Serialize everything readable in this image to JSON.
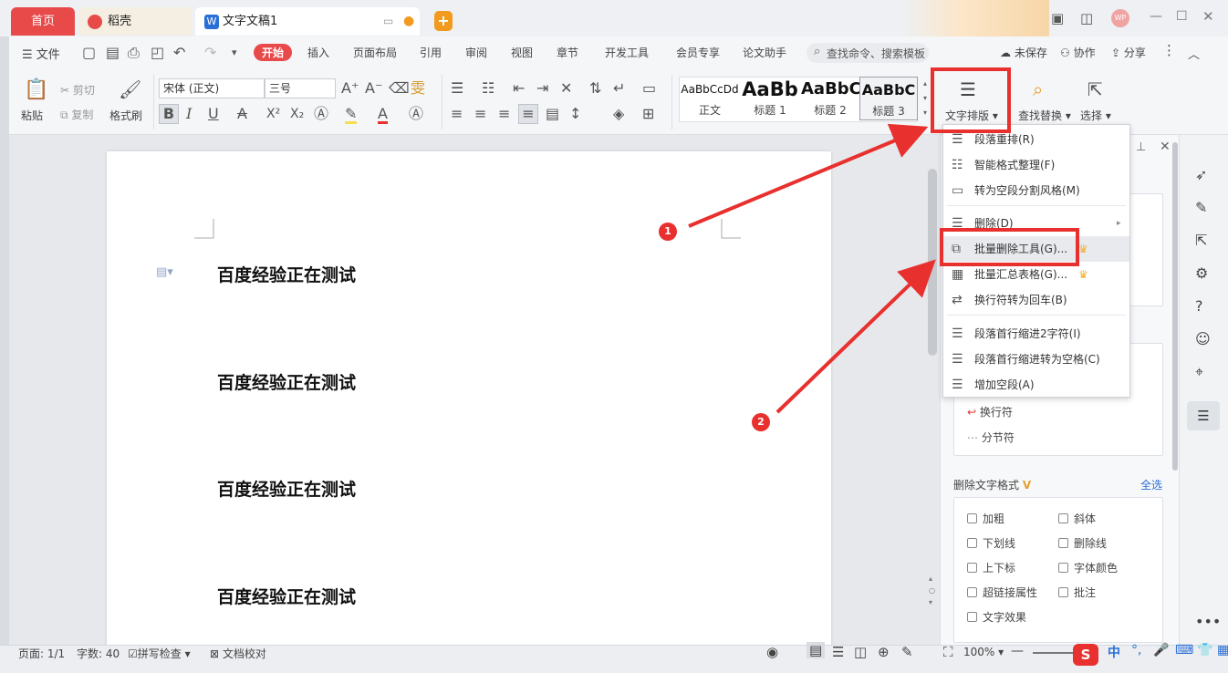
{
  "tabs": {
    "home": "首页",
    "docer": "稻壳",
    "document": "文字文稿1"
  },
  "window": {
    "avatar": "WP"
  },
  "menubar": {
    "file": "文件",
    "items": [
      "开始",
      "插入",
      "页面布局",
      "引用",
      "审阅",
      "视图",
      "章节",
      "开发工具",
      "会员专享",
      "论文助手"
    ],
    "search_placeholder": "查找命令、搜索模板",
    "unsaved": "未保存",
    "collaborate": "协作",
    "share": "分享"
  },
  "ribbon": {
    "paste": "粘贴",
    "cut": "剪切",
    "copy": "复制",
    "format_painter": "格式刷",
    "font_name": "宋体 (正文)",
    "font_size": "三号",
    "styles": [
      {
        "sample": "AaBbCcDd",
        "name": "正文"
      },
      {
        "sample": "AaBb",
        "name": "标题 1"
      },
      {
        "sample": "AaBbC",
        "name": "标题 2"
      },
      {
        "sample": "AaBbC",
        "name": "标题 3"
      }
    ],
    "text_layout": "文字排版",
    "find_replace": "查找替换",
    "select": "选择"
  },
  "document": {
    "lines": [
      "百度经验正在测试",
      "百度经验正在测试",
      "百度经验正在测试",
      "百度经验正在测试"
    ]
  },
  "dropdown": {
    "items": [
      "段落重排(R)",
      "智能格式整理(F)",
      "转为空段分割风格(M)",
      "删除(D)",
      "批量删除工具(G)...",
      "批量汇总表格(G)...",
      "换行符转为回车(B)",
      "段落首行缩进2字符(I)",
      "段落首行缩进转为空格(C)",
      "增加空段(A)"
    ]
  },
  "panel": {
    "line_break": "换行符",
    "section_break": "分节符",
    "delete_format_title": "删除文字格式",
    "select_all": "全选",
    "checkboxes": [
      "加粗",
      "斜体",
      "下划线",
      "删除线",
      "上下标",
      "字体颜色",
      "超链接属性",
      "批注",
      "文字效果"
    ]
  },
  "annotations": {
    "badge1": "1",
    "badge2": "2"
  },
  "statusbar": {
    "page": "页面: 1/1",
    "words": "字数: 40",
    "spell": "拼写检查",
    "proof": "文档校对",
    "zoom": "100%",
    "ime": "中"
  },
  "colors": {
    "accent_red": "#e8302e",
    "tab_home": "#e84a4a",
    "link_blue": "#2a6fd6"
  }
}
